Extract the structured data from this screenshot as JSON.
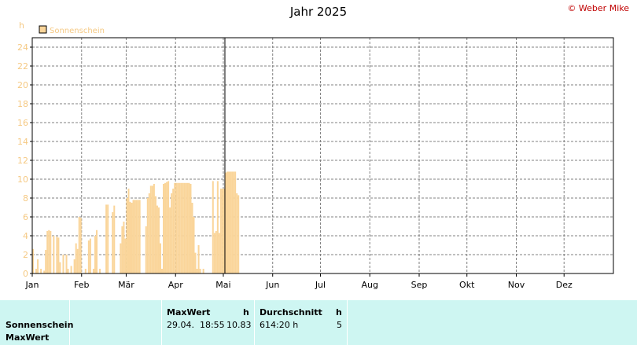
{
  "header": {
    "title": "Jahr 2025",
    "copyright": "© Weber Mike"
  },
  "legend": {
    "label": "Sonnenschein",
    "unit": "h"
  },
  "colors": {
    "bar": "#fad59a",
    "axis_label": "#f5c983",
    "grid": "#808080",
    "footer_bg": "#cef6f2",
    "copyright": "#c00000"
  },
  "chart_data": {
    "type": "bar",
    "title": "Jahr 2025",
    "ylabel": "h",
    "ylim": [
      0,
      25
    ],
    "yticks": [
      0,
      2,
      4,
      6,
      8,
      10,
      12,
      14,
      16,
      18,
      20,
      22,
      24
    ],
    "months": [
      "Jan",
      "Feb",
      "Mär",
      "Apr",
      "Mai",
      "Jun",
      "Jul",
      "Aug",
      "Sep",
      "Okt",
      "Nov",
      "Dez"
    ],
    "grid": true,
    "legend_position": "top-left",
    "current_day": 121,
    "series": [
      {
        "name": "Sonnenschein",
        "x_start_day": 1,
        "values": [
          2.6,
          0,
          0.5,
          1.5,
          0,
          0.5,
          0,
          0.3,
          2.5,
          4.5,
          4.6,
          4.5,
          0,
          4,
          0,
          3.9,
          3.8,
          1.2,
          0,
          2,
          0,
          2,
          0.5,
          0,
          0.8,
          0,
          1.5,
          3.2,
          2.6,
          6,
          5.9,
          0,
          0,
          0.5,
          0,
          3.5,
          3.7,
          0,
          0.5,
          4,
          4.6,
          0,
          0.5,
          0,
          0,
          0,
          7.3,
          7.3,
          0,
          0,
          6.5,
          7.2,
          0,
          0,
          0,
          3.2,
          5,
          5.5,
          3.7,
          8,
          9,
          7.6,
          7.5,
          7.8,
          7.8,
          7.8,
          7.8,
          7.8,
          0,
          0,
          0,
          5,
          8,
          8.5,
          9.3,
          9.3,
          9.5,
          8.2,
          7.2,
          7,
          3.2,
          0.5,
          9.5,
          9.6,
          9.7,
          9.8,
          7,
          8.5,
          9,
          9.6,
          9.6,
          9.6,
          9.6,
          9.6,
          9.6,
          9.6,
          9.6,
          9.6,
          9.6,
          9.5,
          7.5,
          6,
          2.2,
          0.5,
          3,
          0.5,
          0,
          0.5,
          0,
          0,
          0,
          0,
          0,
          9.8,
          4.3,
          4.5,
          9.8,
          4.3,
          9,
          9,
          9,
          10.7,
          10.8,
          10.8,
          10.8,
          10.8,
          10.8,
          10.8,
          8.5,
          8.3
        ]
      }
    ]
  },
  "footer": {
    "row_labels": [
      "Sonnenschein",
      "MaxWert"
    ],
    "maxwert": {
      "header": "MaxWert",
      "unit": "h",
      "datetime": "29.04.  18:55",
      "value": "10.83"
    },
    "average": {
      "header": "Durchschnitt",
      "unit": "h",
      "total": "614:20 h",
      "value": "5"
    }
  }
}
